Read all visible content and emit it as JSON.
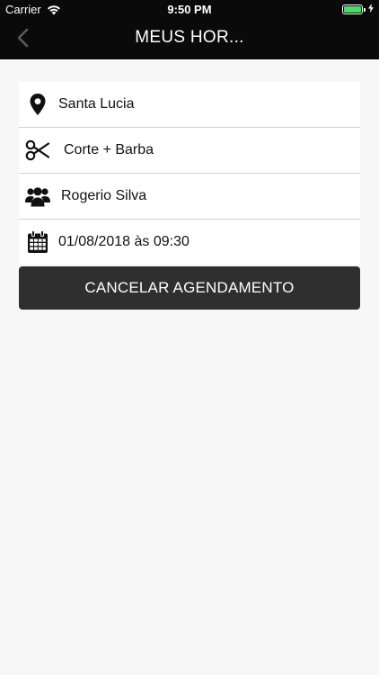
{
  "status_bar": {
    "carrier": "Carrier",
    "time": "9:50 PM",
    "battery_level": 1.0,
    "icons": [
      "wifi-icon",
      "battery-icon",
      "charging-bolt-icon"
    ]
  },
  "nav": {
    "title": "MEUS HOR...",
    "back_icon": "chevron-left-icon"
  },
  "details": {
    "location": "Santa Lucia",
    "service": "Corte + Barba",
    "professional": "Rogerio Silva",
    "datetime": "01/08/2018 às 09:30",
    "icons": [
      "map-pin-icon",
      "scissors-icon",
      "users-icon",
      "calendar-icon"
    ]
  },
  "actions": {
    "cancel_label": "CANCELAR AGENDAMENTO"
  },
  "colors": {
    "topbar_bg": "#0a0a0a",
    "page_bg": "#f7f7f7",
    "card_bg": "#ffffff",
    "divider": "#d2d2d2",
    "button_bg": "#2f2f2f",
    "battery_fill": "#4cd964",
    "back_chevron": "#5a5a5a"
  }
}
